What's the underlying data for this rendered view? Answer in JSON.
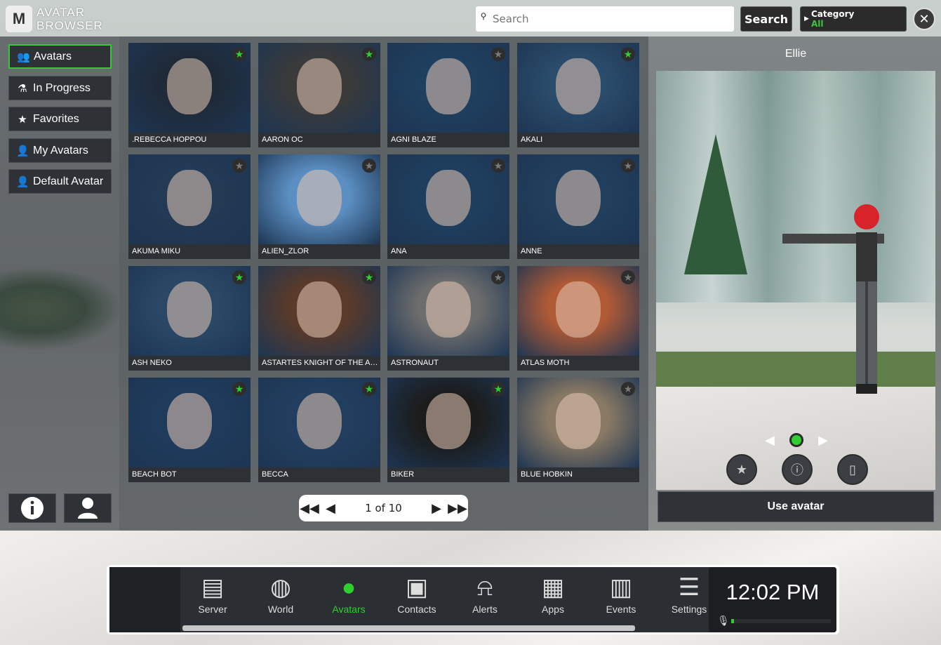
{
  "app": {
    "logo_line1": "AVATAR",
    "logo_line2": "BROWSER",
    "logo_mark": "M"
  },
  "topbar": {
    "search_placeholder": "Search",
    "search_button": "Search",
    "category_label": "Category",
    "category_value": "All"
  },
  "sidebar": {
    "items": [
      {
        "label": "Avatars",
        "icon": "users-icon",
        "active": true
      },
      {
        "label": "In Progress",
        "icon": "flask-icon",
        "active": false
      },
      {
        "label": "Favorites",
        "icon": "star-icon",
        "active": false
      },
      {
        "label": "My Avatars",
        "icon": "user-edit-icon",
        "active": false
      },
      {
        "label": "Default Avatar",
        "icon": "user-icon",
        "active": false
      }
    ]
  },
  "avatars": [
    {
      "name": ".REBECCA HOPPOU",
      "favorite": true,
      "color": "#1e2a38"
    },
    {
      "name": "AARON OC",
      "favorite": true,
      "color": "#3a3a3a"
    },
    {
      "name": "AGNI BLAZE",
      "favorite": false,
      "color": "#1f3f5f"
    },
    {
      "name": "AKALI",
      "favorite": true,
      "color": "#2a4b6a"
    },
    {
      "name": "AKUMA MIKU",
      "favorite": false,
      "color": "#233a55"
    },
    {
      "name": "ALIEN_ZLOR",
      "favorite": false,
      "color": "#5b8fc2"
    },
    {
      "name": "ANA",
      "favorite": false,
      "color": "#1f3e5e"
    },
    {
      "name": "ANNE",
      "favorite": false,
      "color": "#213f5d"
    },
    {
      "name": "ASH NEKO",
      "favorite": true,
      "color": "#2a4866"
    },
    {
      "name": "ASTARTES KNIGHT OF THE AN...",
      "favorite": true,
      "color": "#5a3a2a"
    },
    {
      "name": "ASTRONAUT",
      "favorite": false,
      "color": "#6d6d6d"
    },
    {
      "name": "ATLAS MOTH",
      "favorite": false,
      "color": "#b05a36"
    },
    {
      "name": "BEACH BOT",
      "favorite": true,
      "color": "#1f3b5c"
    },
    {
      "name": "BECCA",
      "favorite": true,
      "color": "#223e5f"
    },
    {
      "name": "BIKER",
      "favorite": true,
      "color": "#1c1c1c"
    },
    {
      "name": "BLUE HOBKIN",
      "favorite": false,
      "color": "#8a7a65"
    }
  ],
  "pager": {
    "text": "1 of 10"
  },
  "preview": {
    "name": "Ellie",
    "use_button": "Use avatar"
  },
  "taskbar": {
    "items": [
      {
        "label": "Server",
        "icon": "server-icon",
        "glyph": "▤",
        "active": false
      },
      {
        "label": "World",
        "icon": "globe-icon",
        "glyph": "◍",
        "active": false
      },
      {
        "label": "Avatars",
        "icon": "avatar-icon",
        "glyph": "●",
        "active": true
      },
      {
        "label": "Contacts",
        "icon": "contacts-icon",
        "glyph": "▣",
        "active": false
      },
      {
        "label": "Alerts",
        "icon": "bell-icon",
        "glyph": "⍾",
        "active": false
      },
      {
        "label": "Apps",
        "icon": "apps-grid-icon",
        "glyph": "▦",
        "active": false
      },
      {
        "label": "Events",
        "icon": "calendar-icon",
        "glyph": "▥",
        "active": false
      },
      {
        "label": "Settings",
        "icon": "sliders-icon",
        "glyph": "☰",
        "active": false
      }
    ],
    "time": "12:02 PM"
  },
  "colors": {
    "accent": "#2fcf2f",
    "panel": "#2e3236"
  }
}
